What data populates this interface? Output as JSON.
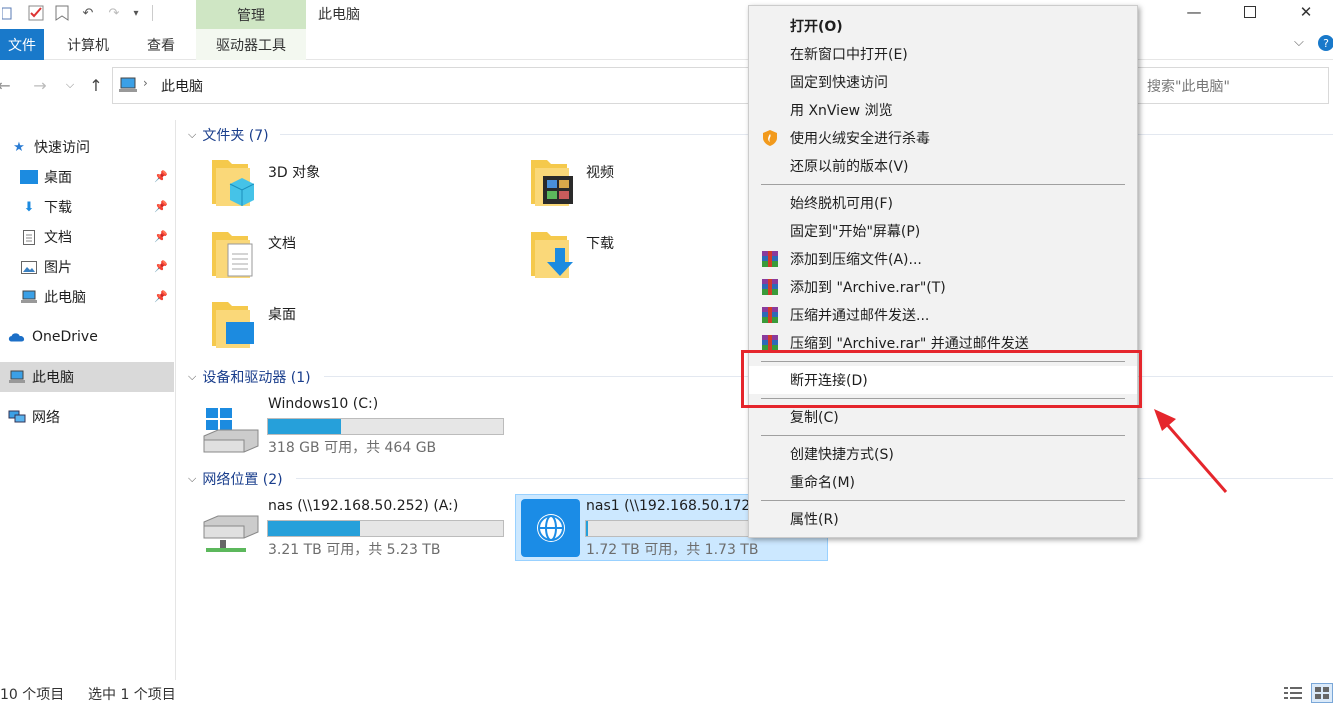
{
  "window": {
    "title": "此电脑",
    "context_tab_group": "管理"
  },
  "ribbon": {
    "tabs": [
      "文件",
      "计算机",
      "查看",
      "驱动器工具"
    ]
  },
  "address": {
    "path": "此电脑",
    "search_placeholder": "搜索\"此电脑\""
  },
  "sidebar": {
    "items": [
      {
        "label": "快速访问"
      },
      {
        "label": "桌面"
      },
      {
        "label": "下载"
      },
      {
        "label": "文档"
      },
      {
        "label": "图片"
      },
      {
        "label": "此电脑"
      },
      {
        "label": "OneDrive"
      },
      {
        "label": "此电脑"
      },
      {
        "label": "网络"
      }
    ]
  },
  "groups": {
    "folders": "文件夹 (7)",
    "devices": "设备和驱动器 (1)",
    "network": "网络位置 (2)"
  },
  "folders": [
    "3D 对象",
    "视频",
    "文档",
    "下载",
    "桌面"
  ],
  "drives": [
    {
      "name": "Windows10 (C:)",
      "info": "318 GB 可用，共 464 GB",
      "used_fraction": 0.31
    },
    {
      "name": "nas (\\\\192.168.50.252) (A:)",
      "info": "3.21 TB 可用，共 5.23 TB",
      "used_fraction": 0.39
    },
    {
      "name": "nas1 (\\\\192.168.50.172",
      "info": "1.72 TB 可用，共 1.73 TB",
      "used_fraction": 0.01
    }
  ],
  "status": {
    "items_count": "10 个项目",
    "selected_count": "选中 1 个项目"
  },
  "context_menu": {
    "items": [
      "打开(O)",
      "在新窗口中打开(E)",
      "固定到快速访问",
      "用 XnView 浏览",
      "使用火绒安全进行杀毒",
      "还原以前的版本(V)",
      "始终脱机可用(F)",
      "固定到\"开始\"屏幕(P)",
      "添加到压缩文件(A)...",
      "添加到 \"Archive.rar\"(T)",
      "压缩并通过邮件发送...",
      "压缩到 \"Archive.rar\" 并通过邮件发送",
      "断开连接(D)",
      "复制(C)",
      "创建快捷方式(S)",
      "重命名(M)",
      "属性(R)"
    ]
  },
  "colors": {
    "accent": "#1979ca",
    "manage_tab": "#cfe6c4",
    "progress": "#26a0da",
    "selection": "#cce8ff",
    "highlight": "#e5262c"
  }
}
